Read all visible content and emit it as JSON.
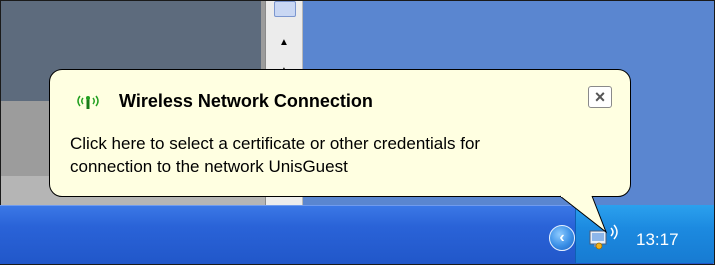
{
  "notification": {
    "title": "Wireless Network Connection",
    "message_line1": "Click here to select a certificate or other credentials for",
    "message_line2": "connection to the network UnisGuest",
    "close_glyph": "×",
    "icon": "wireless-signal-icon"
  },
  "scrollbar": {
    "up_glyph": "▲",
    "second_glyph": "▲"
  },
  "taskbar": {
    "clock": "13:17",
    "show_hidden_icons_glyph": "‹",
    "tray_icon": "wireless-network-icon"
  },
  "colors": {
    "desktop_blue": "#5a86d0",
    "taskbar_blue": "#2a63d8",
    "tray_blue": "#1c8ae0",
    "balloon_bg": "#ffffe1"
  }
}
